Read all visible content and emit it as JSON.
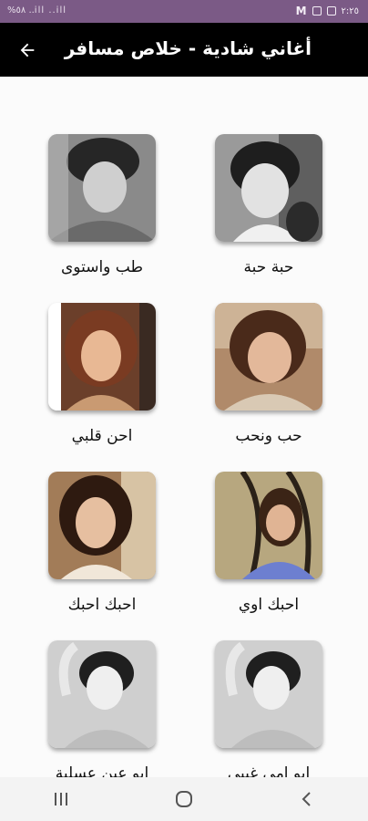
{
  "status_bar": {
    "left_text": "%٥٨ ..ill ..ill",
    "time": "٢:٢٥"
  },
  "header": {
    "title": "أغاني شادية - خلاص مسافر",
    "back_icon": "arrow-left-icon"
  },
  "songs": [
    {
      "title": "حبة حبة"
    },
    {
      "title": "طب واستوى"
    },
    {
      "title": "حب ونحب"
    },
    {
      "title": "احن قلبي"
    },
    {
      "title": "احبك اوي"
    },
    {
      "title": "احبك احبك"
    },
    {
      "title": "ابو امي غيبي"
    },
    {
      "title": "ابو عين عسلية"
    }
  ],
  "nav_bar": {
    "icons": [
      "recent-apps-icon",
      "home-icon",
      "back-icon"
    ]
  },
  "colors": {
    "status_bar": "#7b5a86",
    "app_bar": "#000000",
    "background": "#fbfbfb"
  }
}
